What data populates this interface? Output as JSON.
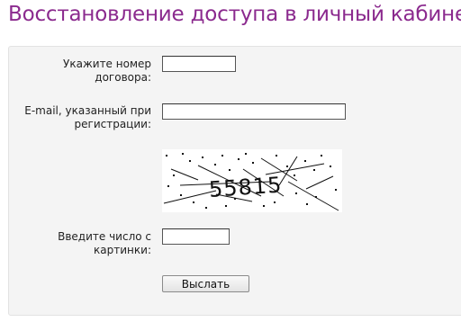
{
  "page": {
    "title": "Восстановление доступа в личный кабинет"
  },
  "form": {
    "contract_label": "Укажите номер\nдоговора:",
    "contract_value": "",
    "email_label": "E-mail, указанный при\nрегистрации:",
    "email_value": "",
    "captcha_text": "55815",
    "captcha_label": "Введите число с\nкартинки:",
    "captcha_value": "",
    "submit_label": "Выслать"
  },
  "colors": {
    "title": "#8b2a8e",
    "panel_background": "#f4f4f4"
  }
}
